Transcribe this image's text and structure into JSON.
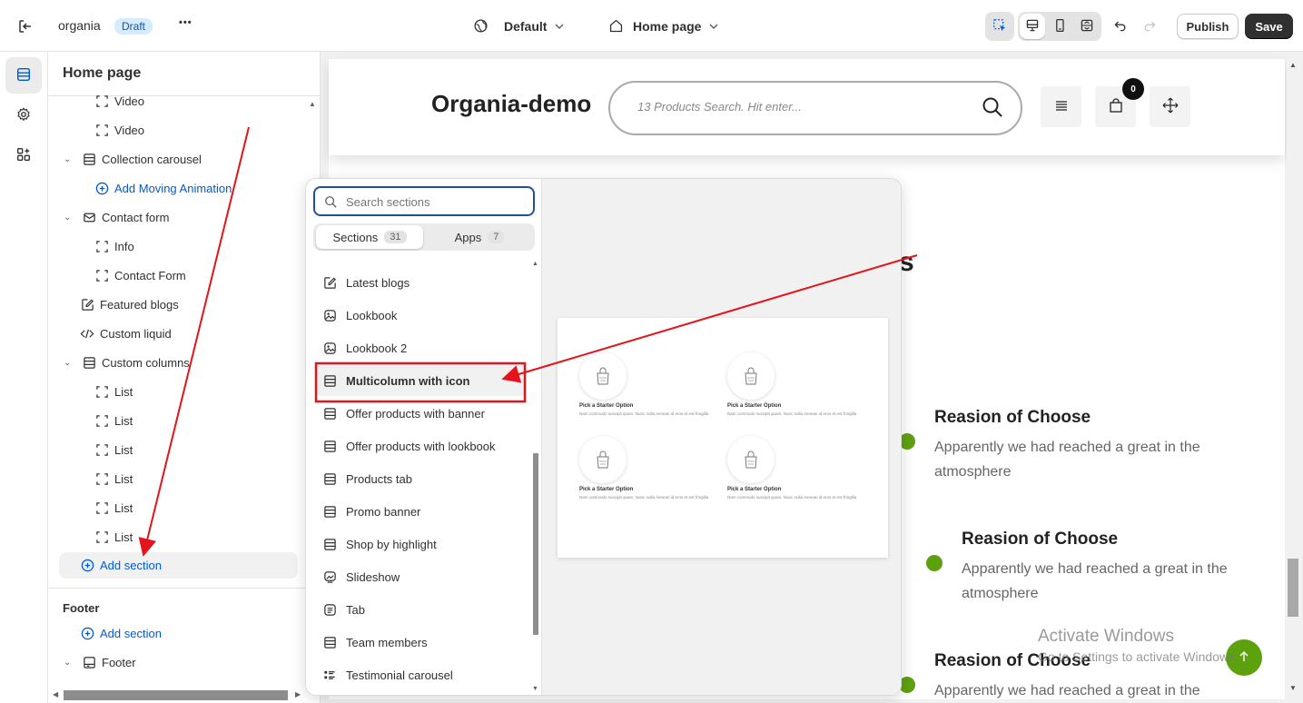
{
  "topbar": {
    "store_name": "organia",
    "status_badge": "Draft",
    "more_label": "•••",
    "theme_select": "Default",
    "page_select": "Home page",
    "publish_label": "Publish",
    "save_label": "Save"
  },
  "sidebar": {
    "title": "Home page",
    "tree": [
      {
        "label": "Video",
        "level": 2,
        "icon": "block-icon"
      },
      {
        "label": "Video",
        "level": 2,
        "icon": "block-icon"
      },
      {
        "label": "Collection carousel",
        "level": 1,
        "icon": "section-icon",
        "chevron": true
      },
      {
        "label": "Add Moving Animation",
        "level": 2,
        "icon": "plus-circle-icon",
        "link": true
      },
      {
        "label": "Contact form",
        "level": 1,
        "icon": "mail-icon",
        "chevron": true
      },
      {
        "label": "Info",
        "level": 2,
        "icon": "block-icon"
      },
      {
        "label": "Contact Form",
        "level": 2,
        "icon": "block-icon"
      },
      {
        "label": "Featured blogs",
        "level": 1,
        "icon": "edit-icon"
      },
      {
        "label": "Custom liquid",
        "level": 1,
        "icon": "code-icon"
      },
      {
        "label": "Custom columns",
        "level": 1,
        "icon": "section-icon",
        "chevron": true
      },
      {
        "label": "List",
        "level": 2,
        "icon": "block-icon"
      },
      {
        "label": "List",
        "level": 2,
        "icon": "block-icon"
      },
      {
        "label": "List",
        "level": 2,
        "icon": "block-icon"
      },
      {
        "label": "List",
        "level": 2,
        "icon": "block-icon"
      },
      {
        "label": "List",
        "level": 2,
        "icon": "block-icon"
      },
      {
        "label": "List",
        "level": 2,
        "icon": "block-icon"
      }
    ],
    "add_section_label": "Add section",
    "footer_group_title": "Footer",
    "footer_add_section_label": "Add section",
    "footer_section_label": "Footer"
  },
  "picker": {
    "search_placeholder": "Search sections",
    "tabs": [
      {
        "label": "Sections",
        "count": "31"
      },
      {
        "label": "Apps",
        "count": "7"
      }
    ],
    "items": [
      {
        "label": "Latest blogs",
        "icon": "edit-icon"
      },
      {
        "label": "Lookbook",
        "icon": "image-icon"
      },
      {
        "label": "Lookbook 2",
        "icon": "image-icon"
      },
      {
        "label": "Multicolumn with icon",
        "icon": "section-icon",
        "selected": true
      },
      {
        "label": "Offer products with banner",
        "icon": "section-icon"
      },
      {
        "label": "Offer products with lookbook",
        "icon": "section-icon"
      },
      {
        "label": "Products tab",
        "icon": "section-icon"
      },
      {
        "label": "Promo banner",
        "icon": "section-icon"
      },
      {
        "label": "Shop by highlight",
        "icon": "section-icon"
      },
      {
        "label": "Slideshow",
        "icon": "slideshow-icon"
      },
      {
        "label": "Tab",
        "icon": "text-icon"
      },
      {
        "label": "Team members",
        "icon": "section-icon"
      },
      {
        "label": "Testimonial carousel",
        "icon": "list-icon"
      }
    ],
    "preview_items": [
      {
        "title": "Pick a Starter Option",
        "desc": "Nam commodo suscipit quam. Nunc nulla Aenean id eros et est fringilla"
      },
      {
        "title": "Pick a Starter Option",
        "desc": "Nam commodo suscipit quam. Nunc nulla Aenean id eros et est fringilla"
      },
      {
        "title": "Pick a Starter Option",
        "desc": "Nam commodo suscipit quam. Nunc nulla Aenean id eros et est fringilla"
      },
      {
        "title": "Pick a Starter Option",
        "desc": "Nam commodo suscipit quam. Nunc nulla Aenean id eros et est fringilla"
      }
    ]
  },
  "store": {
    "logo": "Organia-demo",
    "search_placeholder": "13 Products Search. Hit enter...",
    "cart_count": "0",
    "heading_fragment": "s",
    "reasons": [
      {
        "title": "Reasion of Choose",
        "text": "Apparently we had reached a great in the atmosphere"
      },
      {
        "title": "Reasion of Choose",
        "text": "Apparently we had reached a great in the atmosphere"
      },
      {
        "title": "Reasion of Choose",
        "text": "Apparently we had reached a great in the"
      }
    ]
  },
  "watermark": {
    "title": "Activate Windows",
    "subtitle": "Go to Settings to activate Windows."
  },
  "colors": {
    "accent_blue": "#005bd3",
    "annotation_red": "#e3141b",
    "green_dot": "#5ea10f",
    "save_bg": "#303030"
  }
}
